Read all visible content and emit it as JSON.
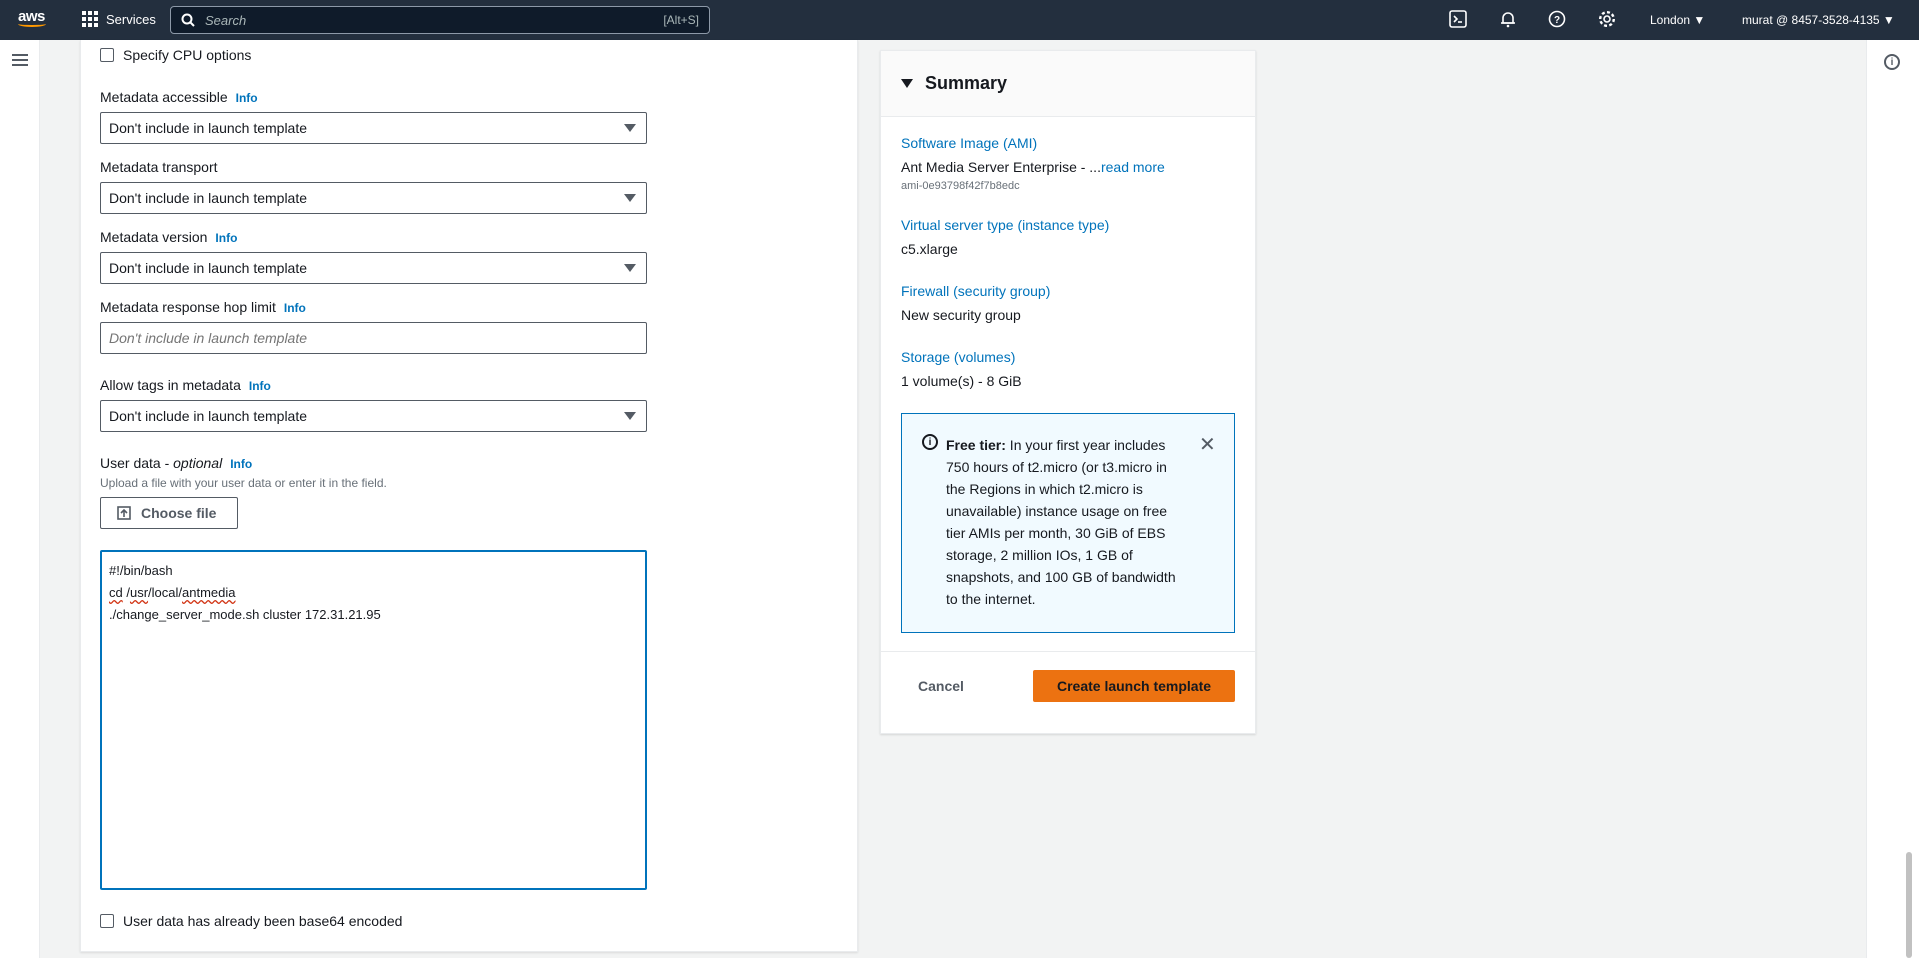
{
  "topnav": {
    "logo_text": "aws",
    "services_label": "Services",
    "search_placeholder": "Search",
    "search_shortcut": "[Alt+S]",
    "region": "London ▼",
    "account": "murat @ 8457-3528-4135 ▼"
  },
  "form": {
    "cpu_options_label": "Specify CPU options",
    "metadata_accessible": {
      "label": "Metadata accessible",
      "info": "Info",
      "value": "Don't include in launch template"
    },
    "metadata_transport": {
      "label": "Metadata transport",
      "value": "Don't include in launch template"
    },
    "metadata_version": {
      "label": "Metadata version",
      "info": "Info",
      "value": "Don't include in launch template"
    },
    "hop_limit": {
      "label": "Metadata response hop limit",
      "info": "Info",
      "placeholder": "Don't include in launch template"
    },
    "allow_tags": {
      "label": "Allow tags in metadata",
      "info": "Info",
      "value": "Don't include in launch template"
    },
    "user_data": {
      "label": "User data - ",
      "optional": "optional",
      "info": "Info",
      "hint": "Upload a file with your user data or enter it in the field.",
      "choose_file": "Choose file",
      "line1": "#!/bin/bash",
      "line2_cmd": "cd",
      "line2_usr": "usr",
      "line2_local": "local",
      "line2_antmedia": "antmedia",
      "line3": "./change_server_mode.sh cluster 172.31.21.95"
    },
    "base64_label": "User data has already been base64 encoded"
  },
  "summary": {
    "title": "Summary",
    "ami_label": "Software Image (AMI)",
    "ami_value": "Ant Media Server Enterprise - ...",
    "ami_read_more": "read more",
    "ami_id": "ami-0e93798f42f7b8edc",
    "instance_label": "Virtual server type (instance type)",
    "instance_value": "c5.xlarge",
    "firewall_label": "Firewall (security group)",
    "firewall_value": "New security group",
    "storage_label": "Storage (volumes)",
    "storage_value": "1 volume(s) - 8 GiB",
    "free_tier_bold": "Free tier:",
    "free_tier_text": " In your first year includes 750 hours of t2.micro (or t3.micro in the Regions in which t2.micro is unavailable) instance usage on free tier AMIs per month, 30 GiB of EBS storage, 2 million IOs, 1 GB of snapshots, and 100 GB of bandwidth to the internet.",
    "cancel": "Cancel",
    "create": "Create launch template"
  },
  "colors": {
    "nav_bg": "#232f3e",
    "link": "#0073bb",
    "primary_button": "#ec7211"
  }
}
